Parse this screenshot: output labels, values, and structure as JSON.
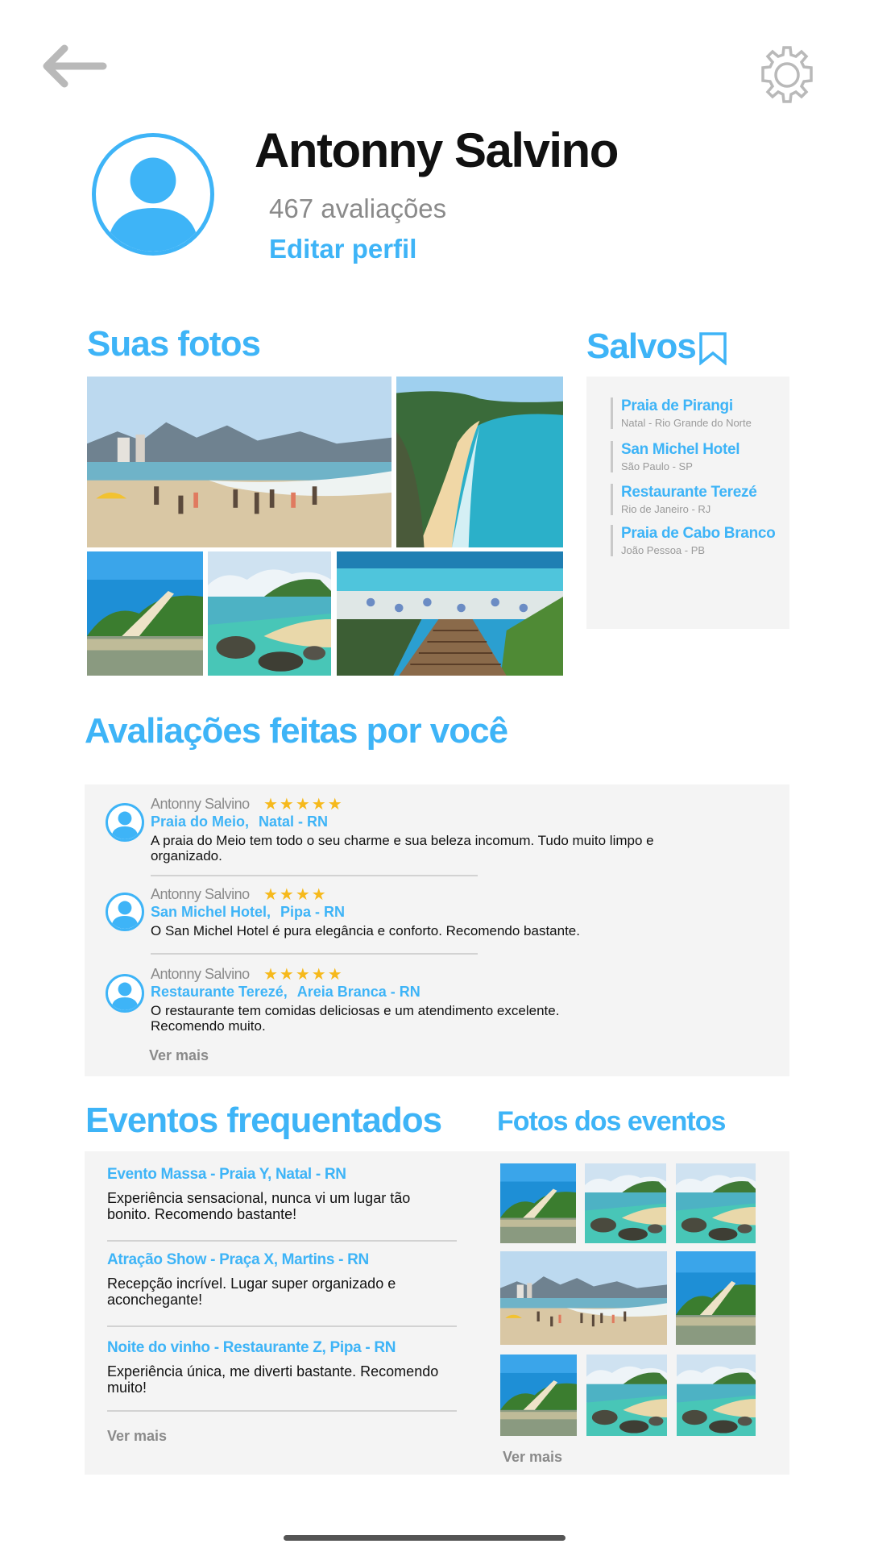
{
  "header": {
    "back_icon": "arrow-left-icon",
    "settings_icon": "gear-icon"
  },
  "profile": {
    "name": "Antonny Salvino",
    "review_count": "467 avaliações",
    "edit_label": "Editar perfil",
    "avatar_icon": "user-avatar-icon"
  },
  "photos": {
    "title": "Suas fotos",
    "items": [
      "beach-city-photo",
      "beach-cliff-photo",
      "dune-lagoon-photo",
      "rocky-pools-photo",
      "beach-stairs-photo"
    ]
  },
  "saved": {
    "title": "Salvos",
    "icon": "bookmark-icon",
    "items": [
      {
        "title": "Praia de Pirangi",
        "subtitle": "Natal - Rio Grande do Norte"
      },
      {
        "title": "San Michel Hotel",
        "subtitle": "São  Paulo - SP"
      },
      {
        "title": "Restaurante Terezé",
        "subtitle": "Rio de Janeiro - RJ"
      },
      {
        "title": "Praia de Cabo Branco",
        "subtitle": "João Pessoa - PB"
      }
    ]
  },
  "reviews": {
    "title": "Avaliações feitas por você",
    "more_label": "Ver mais",
    "items": [
      {
        "author": "Antonny Salvino",
        "stars": "★★★★★",
        "rating": 5,
        "place": "Praia do Meio,",
        "city": "Natal - RN",
        "text": "A praia do Meio tem todo o seu charme e sua beleza incomum. Tudo muito limpo e organizado."
      },
      {
        "author": "Antonny Salvino",
        "stars": "★★★★",
        "rating": 4,
        "place": "San Michel Hotel,",
        "city": "Pipa - RN",
        "text": "O San Michel Hotel é pura elegância e conforto. Recomendo bastante."
      },
      {
        "author": "Antonny Salvino",
        "stars": "★★★★★",
        "rating": 5,
        "place": "Restaurante Terezé,",
        "city": "Areia Branca - RN",
        "text": "O restaurante tem comidas deliciosas e um atendimento excelente. Recomendo muito."
      }
    ]
  },
  "events": {
    "title": "Eventos frequentados",
    "more_label": "Ver mais",
    "items": [
      {
        "title": "Evento Massa - Praia Y,   Natal - RN",
        "text": "Experiência sensacional, nunca vi um lugar tão bonito. Recomendo bastante!"
      },
      {
        "title": "Atração Show - Praça X, Martins - RN",
        "text": "Recepção incrível. Lugar super organizado e aconchegante!"
      },
      {
        "title": "Noite do vinho - Restaurante Z, Pipa - RN",
        "text": "Experiência única, me diverti bastante. Recomendo muito!"
      }
    ]
  },
  "event_photos": {
    "title": "Fotos dos eventos",
    "more_label": "Ver mais"
  },
  "colors": {
    "accent": "#3eb4f7",
    "star": "#f6b91c",
    "panel": "#f4f4f4"
  }
}
